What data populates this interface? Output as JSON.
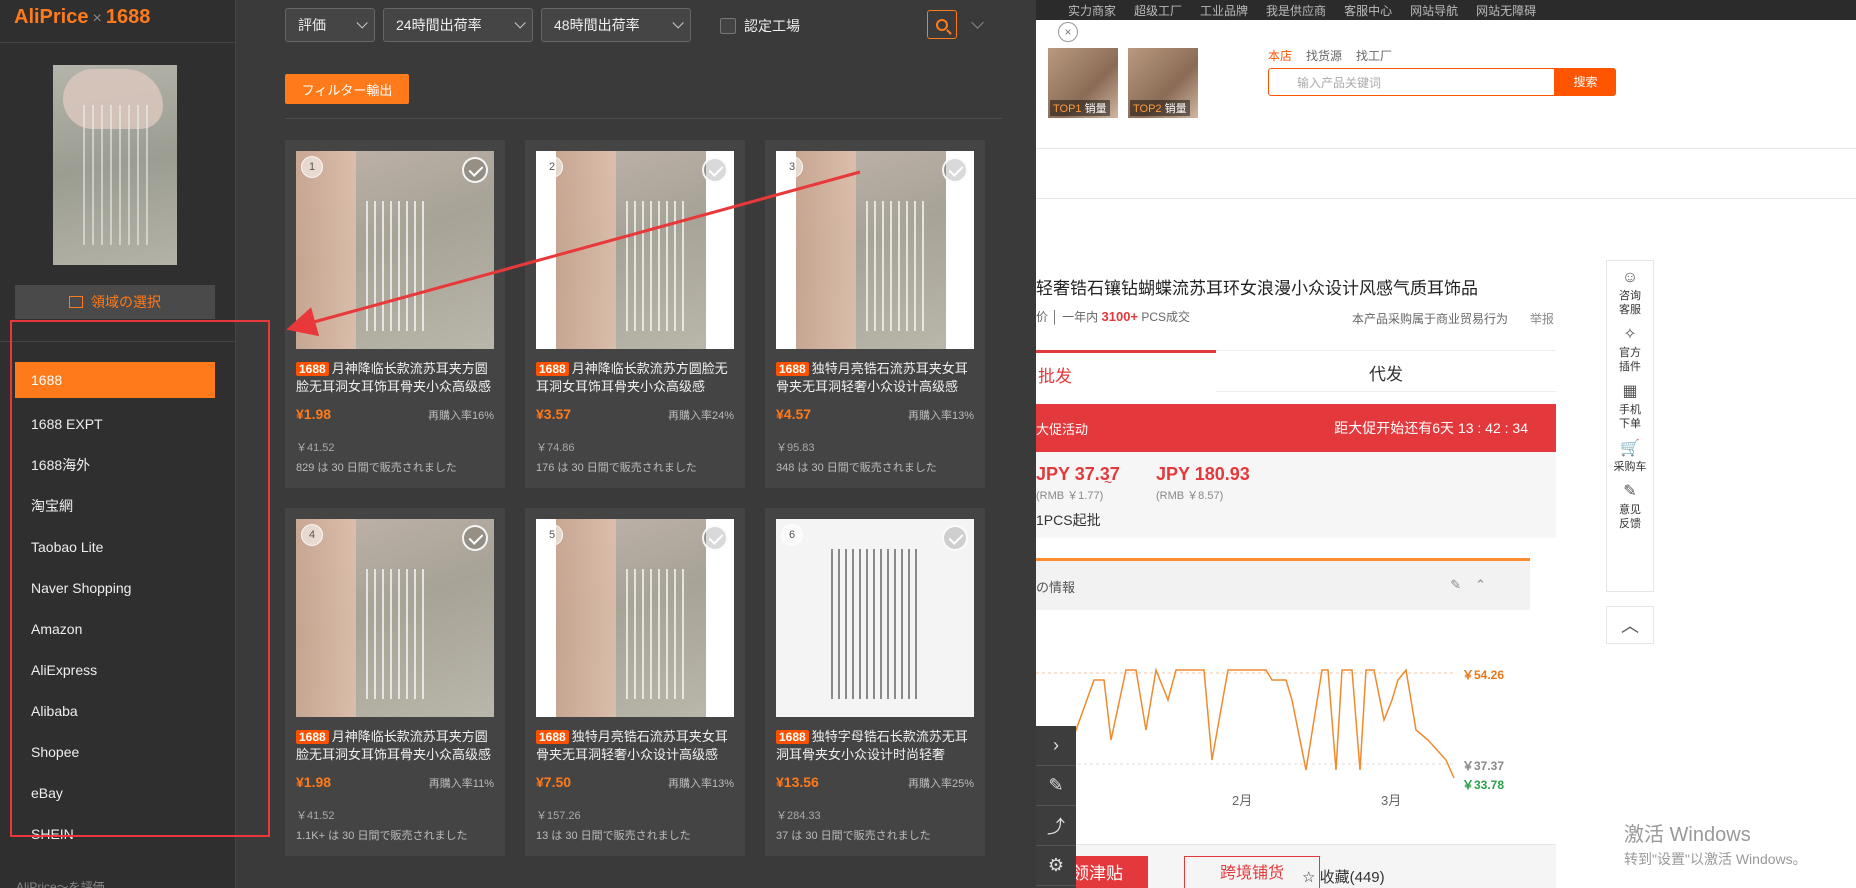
{
  "brand": {
    "name": "AliPrice",
    "sep": "×",
    "partner": "1688"
  },
  "sidebar": {
    "area_select_label": "領域の選択",
    "sites": [
      {
        "label": "1688",
        "active": true
      },
      {
        "label": "1688 EXPT"
      },
      {
        "label": "1688海外"
      },
      {
        "label": "淘宝網"
      },
      {
        "label": "Taobao Lite"
      },
      {
        "label": "Naver Shopping"
      },
      {
        "label": "Amazon"
      },
      {
        "label": "AliExpress"
      },
      {
        "label": "Alibaba"
      },
      {
        "label": "Shopee"
      },
      {
        "label": "eBay"
      },
      {
        "label": "SHEIN"
      }
    ],
    "footer_text": "AliPrice～を評価"
  },
  "filters": {
    "sort": "評価",
    "ship24": "24時間出荷率",
    "ship48": "48時間出荷率",
    "factory_label": "認定工場",
    "export_label": "フィルター輸出"
  },
  "products": [
    {
      "index": "1",
      "badge": "1688",
      "title": "月神降临长款流苏耳夹方圆脸无耳洞女耳饰耳骨夹小众高级感",
      "price": "¥1.98",
      "rebuy": "再購入率16%",
      "orig_price": "￥41.52",
      "sold": "829 は 30 日間で販売されました",
      "img": "a"
    },
    {
      "index": "2",
      "badge": "1688",
      "title": "月神降临长款流苏方圆脸无耳洞女耳饰耳骨夹小众高级感",
      "price": "¥3.57",
      "rebuy": "再購入率24%",
      "orig_price": "￥74.86",
      "sold": "176 は 30 日間で販売されました",
      "img": "b"
    },
    {
      "index": "3",
      "badge": "1688",
      "title": "独特月亮锆石流苏耳夹女耳骨夹无耳洞轻奢小众设计高级感",
      "price": "¥4.57",
      "rebuy": "再購入率13%",
      "orig_price": "￥95.83",
      "sold": "348 は 30 日間で販売されました",
      "img": "b"
    },
    {
      "index": "4",
      "badge": "1688",
      "title": "月神降临长款流苏耳夹方圆脸无耳洞女耳饰耳骨夹小众高级感",
      "price": "¥1.98",
      "rebuy": "再購入率11%",
      "orig_price": "￥41.52",
      "sold": "1.1K+ は 30 日間で販売されました",
      "img": "a"
    },
    {
      "index": "5",
      "badge": "1688",
      "title": "独特月亮锆石流苏耳夹女耳骨夹无耳洞轻奢小众设计高级感",
      "price": "¥7.50",
      "rebuy": "再購入率13%",
      "orig_price": "￥157.26",
      "sold": "13 は 30 日間で販売されました",
      "img": "b"
    },
    {
      "index": "6",
      "badge": "1688",
      "title": "独特字母锆石长款流苏无耳洞耳骨夹女小众设计时尚轻奢",
      "price": "¥13.56",
      "rebuy": "再購入率25%",
      "orig_price": "￥284.33",
      "sold": "37 は 30 日間で販売されました",
      "img": "c"
    }
  ],
  "bg": {
    "topnav": [
      "实力商家",
      "超级工厂",
      "工业品牌",
      "我是供应商",
      "客服中心",
      "网站导航",
      "网站无障碍"
    ],
    "close": "×",
    "thumb1": {
      "rank": "TOP1",
      "label": "销量"
    },
    "thumb2": {
      "rank": "TOP2",
      "label": "销量"
    },
    "search_tabs": [
      "本店",
      "找货源",
      "找工厂"
    ],
    "search_placeholder": "输入产品关键词",
    "search_btn": "搜索",
    "title": "轻奢锆石镶钻蝴蝶流苏耳环女浪漫小众设计风感气质耳饰品",
    "sales_prefix": "价 │ 一年内",
    "sales_count": "3100+",
    "sales_suffix": "PCS成交",
    "trade_note": "本产品采购属于商业贸易行为",
    "report": "举报",
    "tab_wholesale": "批发",
    "tab_proxy": "代发",
    "promo_left": "大促活动",
    "promo_right": "距大促开始还有6天 13 : 42 : 34",
    "price_low": "JPY 37.37",
    "price_low_rmb": "(RMB ￥1.77)",
    "price_high": "JPY 180.93",
    "price_high_rmb": "(RMB ￥8.57)",
    "moq": "1PCS起批",
    "info_label": "の情報",
    "chart_labels": {
      "high": "￥54.26",
      "mid": "￥37.37",
      "low": "￥33.78",
      "m2": "2月",
      "m3": "3月"
    },
    "side_items": [
      {
        "icon": "☺",
        "label": "咨询\n客服",
        "name": "consult-icon"
      },
      {
        "icon": "✧",
        "label": "官方\n插件",
        "name": "plugin-icon"
      },
      {
        "icon": "▦",
        "label": "手机\n下单",
        "name": "qr-icon"
      },
      {
        "icon": "🛒",
        "label": "采购车",
        "name": "cart-icon"
      },
      {
        "icon": "✎",
        "label": "意见\n反馈",
        "name": "feedback-icon"
      }
    ],
    "btn_red": "领津贴",
    "btn_outline": "跨境铺货",
    "fav": "☆ 收藏(449)",
    "win_line1": "激活 Windows",
    "win_line2": "转到\"设置\"以激活 Windows。"
  }
}
